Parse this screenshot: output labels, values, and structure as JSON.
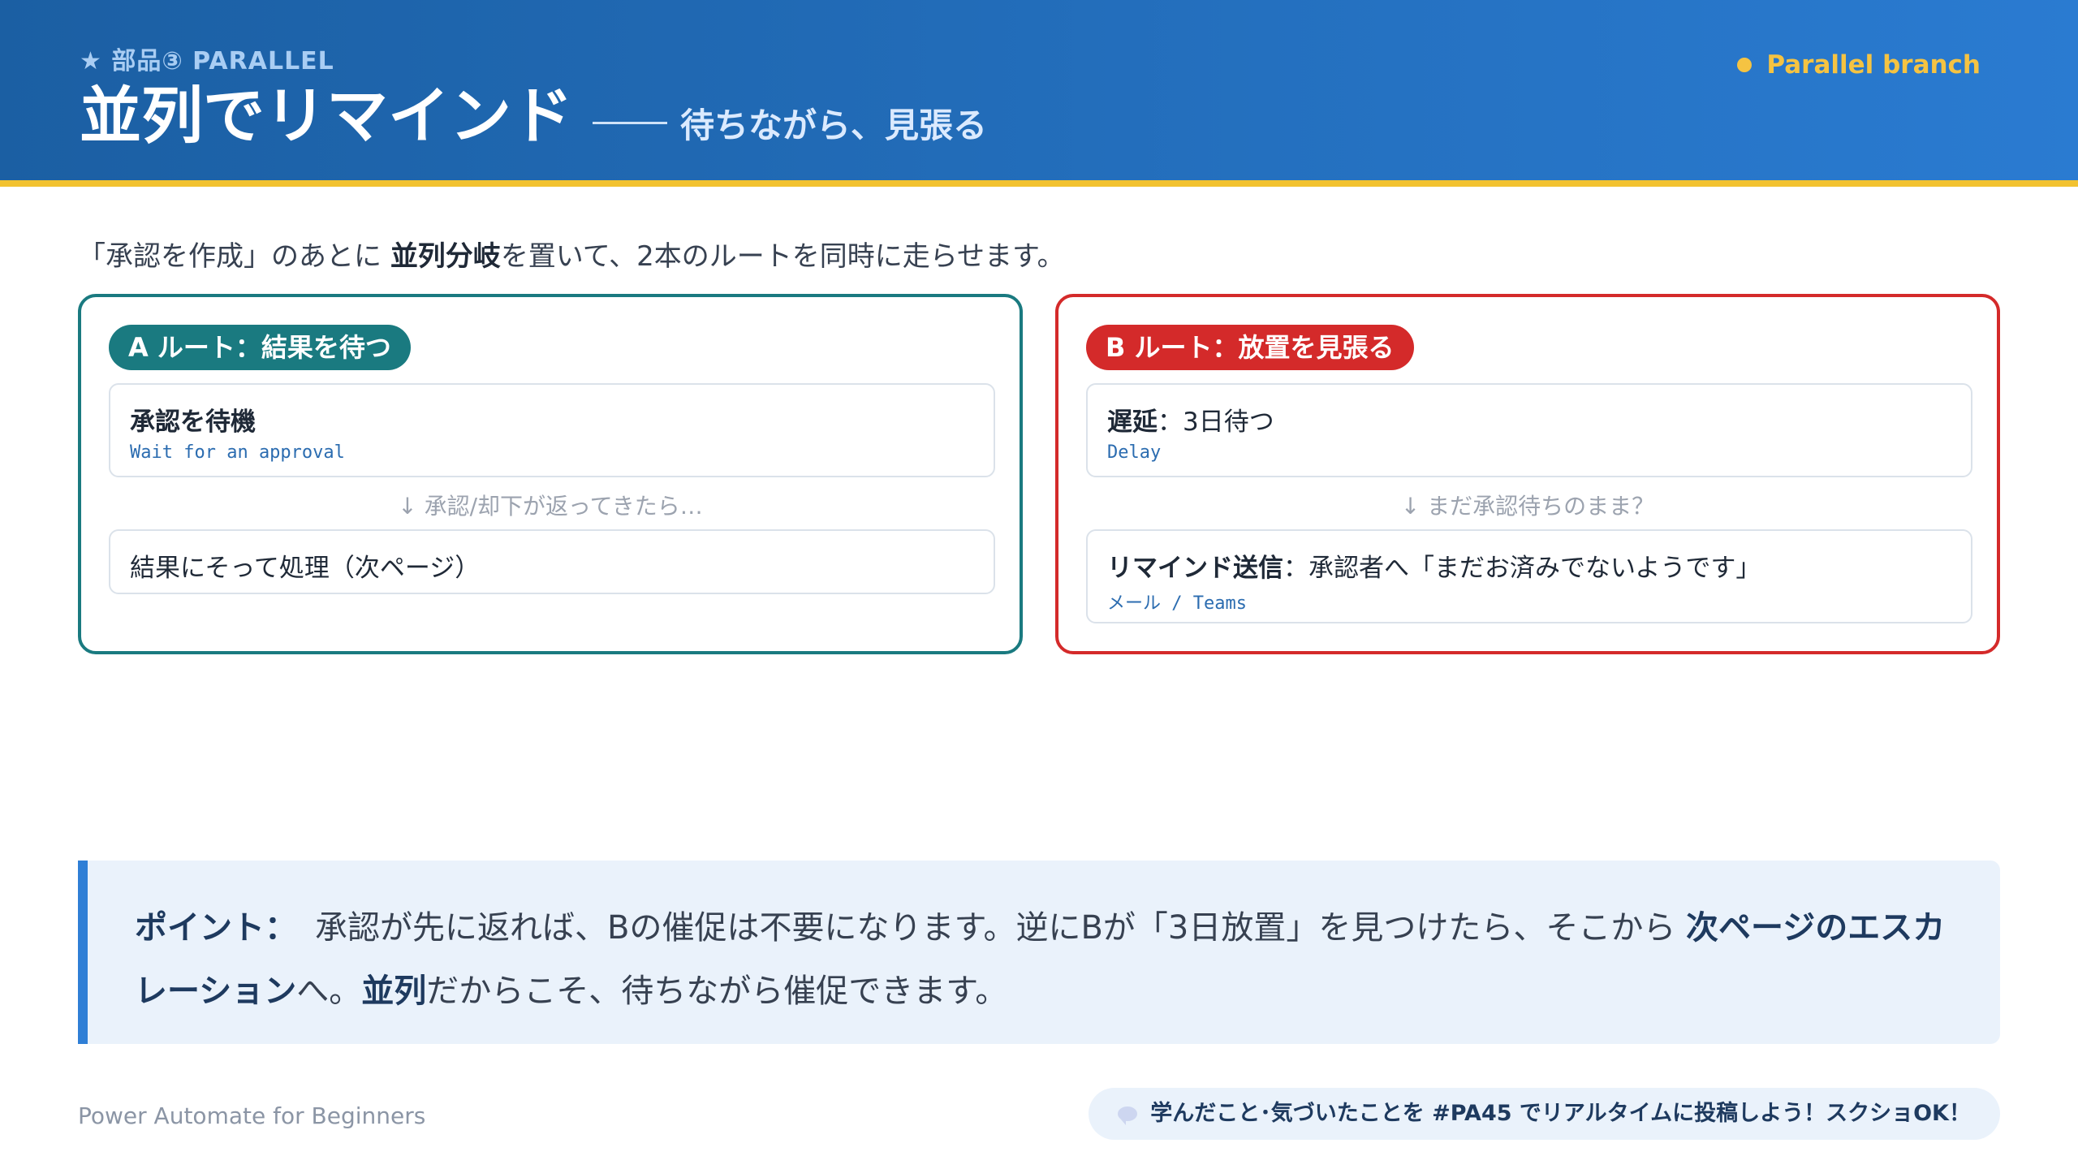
{
  "header": {
    "kicker": "★ 部品③ PARALLEL",
    "title": "並列でリマインド",
    "subtitle": "待ちながら、見張る",
    "badge": "Parallel branch"
  },
  "lead": {
    "pre": "「承認を作成」のあとに ",
    "bold": "並列分岐",
    "post": "を置いて、2本のルートを同時に走らせます。"
  },
  "route_a": {
    "label": "A ルート：結果を待つ",
    "step1_title": "承認を待機",
    "step1_sub": "Wait for an approval",
    "arrow": "↓ 承認/却下が返ってきたら…",
    "step2_title": "結果にそって処理（次ページ）"
  },
  "route_b": {
    "label": "B ルート：放置を見張る",
    "step1_bold": "遅延",
    "step1_rest": "：3日待つ",
    "step1_sub": "Delay",
    "arrow": "↓ まだ承認待ちのまま？",
    "step2_bold": "リマインド送信",
    "step2_rest": "：承認者へ「まだお済みでないようです」",
    "step2_sub": "メール / Teams"
  },
  "point": {
    "label": "ポイント：",
    "text1": "承認が先に返れば、Bの催促は不要になります。逆にBが「3日放置」を見つけたら、そこから ",
    "bold1": "次ページのエスカレーション",
    "text2": "へ。",
    "bold2": "並列",
    "text3": "だからこそ、待ちながら催促できます。"
  },
  "footer": {
    "left": "Power Automate for Beginners",
    "right": "学んだこと･気づいたことを #PA45 でリアルタイムに投稿しよう！スクショOK！"
  },
  "colors": {
    "header_start": "#1b5fa3",
    "header_end": "#2a7bd1",
    "accent_yellow": "#f2c230",
    "route_a": "#1a7a80",
    "route_b": "#d42a2a",
    "point_border": "#2f7fd6"
  }
}
